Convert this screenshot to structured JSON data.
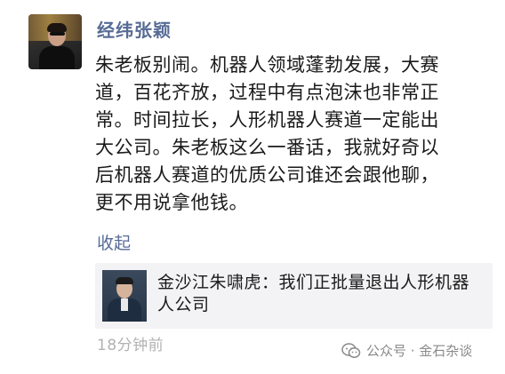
{
  "post": {
    "author": "经纬张颖",
    "content_lines": [
      "朱老板别闹。机器人领域蓬勃发展，大赛",
      "道，百花齐放，过程中有点泡沫也非常正",
      "常。时间拉长，人形机器人赛道一定能出",
      "大公司。朱老板这么一番话，我就好奇以",
      "后机器人赛道的优质公司谁还会跟他聊，",
      "更不用说拿他钱。"
    ],
    "collapse_label": "收起",
    "shared": {
      "title_lines": [
        "金沙江朱啸虎：我们正批量退出人形机器",
        "人公司"
      ]
    },
    "time": "18分钟前"
  },
  "watermark": {
    "text": "公众号 · 金石杂谈",
    "icon": "wechat-official-account-icon"
  }
}
